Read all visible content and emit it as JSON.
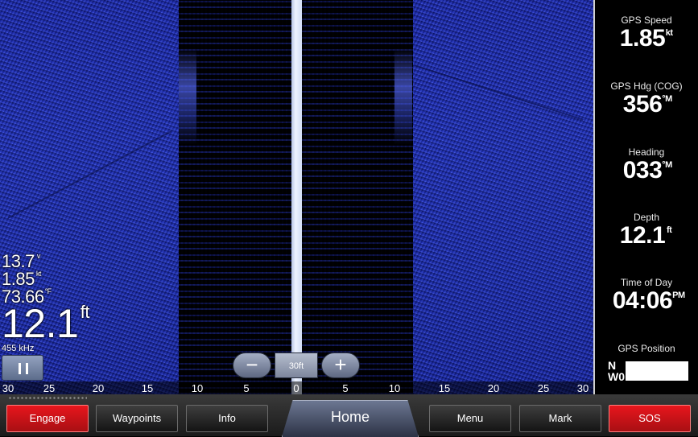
{
  "left_overlay": {
    "voltage": "13.7",
    "voltage_unit": "v",
    "speed": "1.85",
    "speed_unit": "kt",
    "temperature": "73.66",
    "temperature_unit": "°F",
    "depth": "12.1",
    "depth_unit": "ft",
    "frequency": "455 kHz"
  },
  "zoom": {
    "minus": "−",
    "range": "30ft",
    "plus": "+"
  },
  "scale": {
    "labels": [
      "30",
      "25",
      "20",
      "15",
      "10",
      "5",
      "0",
      "5",
      "10",
      "15",
      "20",
      "25",
      "30"
    ]
  },
  "data_panel": {
    "gps_speed": {
      "label": "GPS Speed",
      "value": "1.85",
      "unit": "kt"
    },
    "gps_heading": {
      "label": "GPS Hdg (COG)",
      "value": "356",
      "unit": "°M"
    },
    "heading": {
      "label": "Heading",
      "value": "033",
      "unit": "°M"
    },
    "depth": {
      "label": "Depth",
      "value": "12.1",
      "unit": "ft"
    },
    "time_of_day": {
      "label": "Time of Day",
      "value": "04:06",
      "unit": "PM"
    },
    "gps_position": {
      "label": "GPS Position",
      "lat_prefix": "N",
      "lon_prefix": "W0"
    }
  },
  "bottom_bar": {
    "engage": "Engage",
    "waypoints": "Waypoints",
    "info": "Info",
    "home": "Home",
    "menu": "Menu",
    "mark": "Mark",
    "sos": "SOS"
  },
  "colors": {
    "sonar_blue": "#2236bf",
    "alert_red": "#d8131a",
    "panel_bg": "#000000"
  }
}
